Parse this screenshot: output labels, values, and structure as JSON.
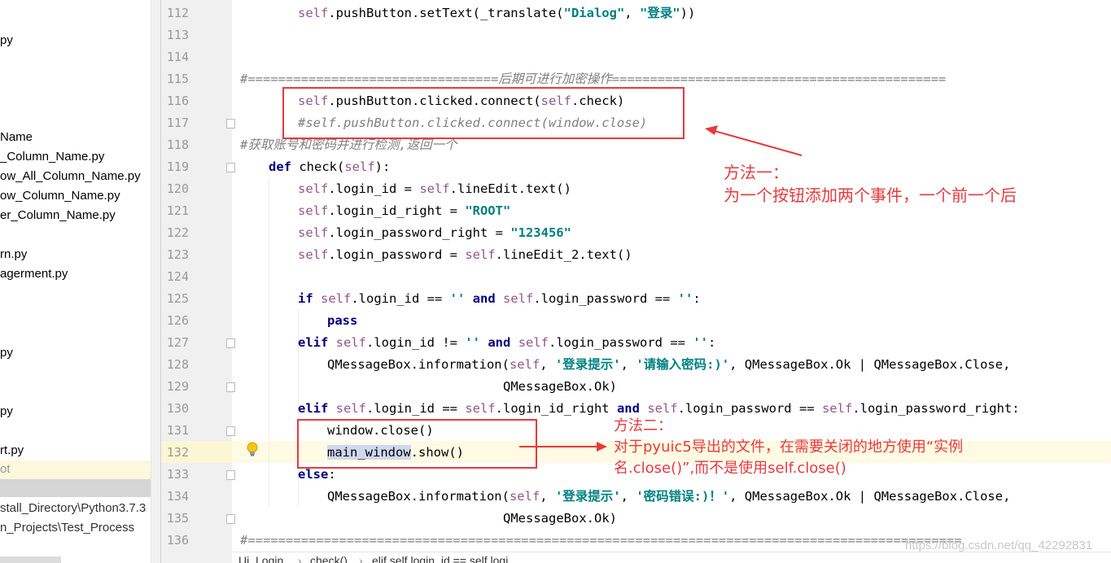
{
  "tree": {
    "items": [
      {
        "text": "py",
        "top": 0
      },
      {
        "text": "Name",
        "top": 0
      },
      {
        "text": "_Column_Name.py",
        "top": 0
      },
      {
        "text": "ow_All_Column_Name.py",
        "top": 0
      },
      {
        "text": "ow_Column_Name.py",
        "top": 0
      },
      {
        "text": "er_Column_Name.py",
        "top": 0
      },
      {
        "text": "rn.py",
        "top": 0
      },
      {
        "text": "agerment.py",
        "top": 0
      },
      {
        "text": "py",
        "top": 0
      },
      {
        "text": "py",
        "top": 0
      },
      {
        "text": "rt.py",
        "top": 0
      },
      {
        "text": "ot",
        "top": 0
      },
      {
        "text": "stall_Directory\\Python3.7.3",
        "top": 0
      },
      {
        "text": "n_Projects\\Test_Process",
        "top": 0
      }
    ]
  },
  "lines": [
    "112",
    "113",
    "114",
    "115",
    "116",
    "117",
    "118",
    "119",
    "120",
    "121",
    "122",
    "123",
    "124",
    "125",
    "126",
    "127",
    "128",
    "129",
    "130",
    "131",
    "132",
    "133",
    "134",
    "135",
    "136"
  ],
  "code": {
    "l112_a": "self",
    "l112_b": ".pushButton.setText(_translate(",
    "l112_c": "\"Dialog\"",
    "l112_d": ", ",
    "l112_e": "\"登录\"",
    "l112_f": "))",
    "l115": "#=================================后期可进行加密操作============================================",
    "l116_a": "self",
    "l116_b": ".pushButton.clicked.connect(",
    "l116_c": "self",
    "l116_d": ".check)",
    "l117": "#self.pushButton.clicked.connect(window.close)",
    "l118": "#获取账号和密码并进行检测,返回一个",
    "l119_kw": "def",
    "l119_b": " check(",
    "l119_c": "self",
    "l119_d": "):",
    "l120_a": "self",
    "l120_b": ".login_id = ",
    "l120_c": "self",
    "l120_d": ".lineEdit.text()",
    "l121_a": "self",
    "l121_b": ".login_id_right = ",
    "l121_c": "\"ROOT\"",
    "l122_a": "self",
    "l122_b": ".login_password_right = ",
    "l122_c": "\"123456\"",
    "l123_a": "self",
    "l123_b": ".login_password = ",
    "l123_c": "self",
    "l123_d": ".lineEdit_2.text()",
    "l125_kw": "if",
    "l125_b": "self",
    "l125_c": ".login_id == ",
    "l125_d": "''",
    "l125_kw2": "and",
    "l125_e": "self",
    "l125_f": ".login_password == ",
    "l125_g": "''",
    "l125_h": ":",
    "l126_kw": "pass",
    "l127_kw": "elif",
    "l127_b": "self",
    "l127_c": ".login_id != ",
    "l127_d": "''",
    "l127_kw2": "and",
    "l127_e": "self",
    "l127_f": ".login_password == ",
    "l127_g": "''",
    "l127_h": ":",
    "l128_a": "QMessageBox.information(",
    "l128_b": "self",
    "l128_c": ", ",
    "l128_d": "'登录提示'",
    "l128_e": ", ",
    "l128_f": "'请输入密码:)'",
    "l128_g": ", QMessageBox.Ok | QMessageBox.Close,",
    "l129": "QMessageBox.Ok)",
    "l130_kw": "elif",
    "l130_b": "self",
    "l130_c": ".login_id == ",
    "l130_d": "self",
    "l130_e": ".login_id_right ",
    "l130_kw2": "and",
    "l130_f": "self",
    "l130_g": ".login_password == ",
    "l130_h": "self",
    "l130_i": ".login_password_right:",
    "l131": "window.close()",
    "l132_sel": "main_window",
    "l132_b": ".show()",
    "l133_kw": "else",
    "l133_b": ":",
    "l134_a": "QMessageBox.information(",
    "l134_b": "self",
    "l134_c": ", ",
    "l134_d": "'登录提示'",
    "l134_e": ", ",
    "l134_f": "'密码错误:)！'",
    "l134_g": ", QMessageBox.Ok | QMessageBox.Close,",
    "l135": "QMessageBox.Ok)",
    "l136": "#=============================================================================================="
  },
  "annotations": {
    "method1_title": "方法一：",
    "method1_body": "为一个按钮添加两个事件，一个前一个后",
    "method2_title": "方法二：",
    "method2_line1": "对于pyuic5导出的文件，在需要关闭的地方使用“实例",
    "method2_line2": "名.close()”,而不是使用self.close()",
    "color": "#e8393d"
  },
  "breadcrumb": {
    "items": [
      "Ui_Login",
      "check()",
      "elif self.login_id == self.logi"
    ],
    "separator": "›"
  },
  "watermark": "https://blog.csdn.net/qq_42292831"
}
